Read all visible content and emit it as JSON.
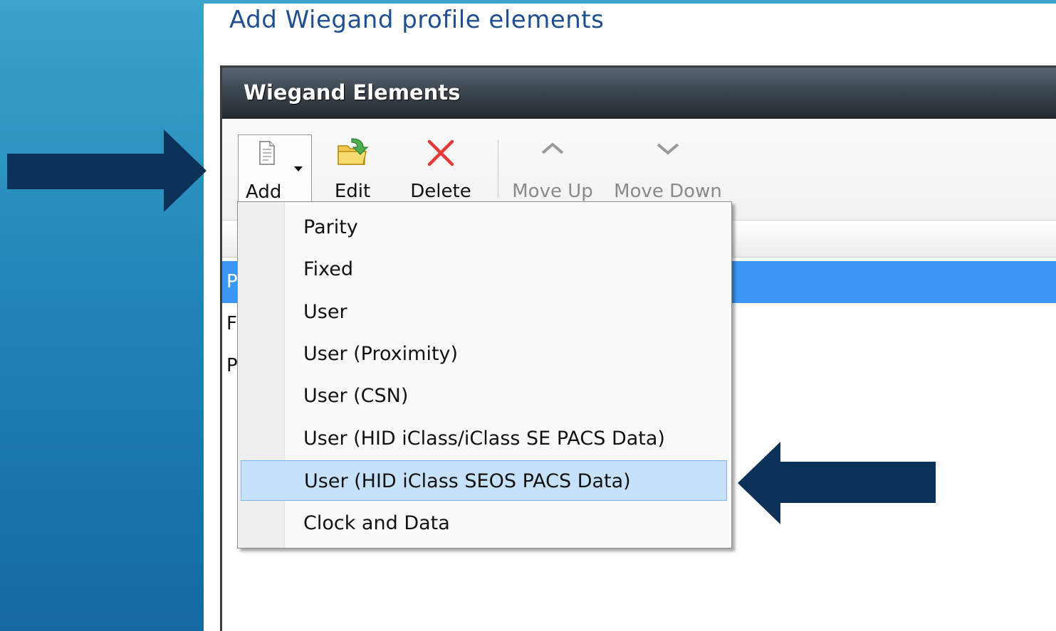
{
  "page": {
    "title": "Add Wiegand profile elements"
  },
  "panel": {
    "title": "Wiegand Elements"
  },
  "toolbar": {
    "add_label": "Add",
    "edit_label": "Edit",
    "delete_label": "Delete",
    "move_up_label": "Move Up",
    "move_down_label": "Move Down",
    "move_up_enabled": false,
    "move_down_enabled": false
  },
  "grid": {
    "rows": [
      {
        "text": "P",
        "selected": true
      },
      {
        "text": "F",
        "selected": false
      },
      {
        "text": "P",
        "selected": false
      }
    ]
  },
  "add_menu": {
    "items": [
      {
        "label": "Parity"
      },
      {
        "label": "Fixed"
      },
      {
        "label": "User"
      },
      {
        "label": "User (Proximity)"
      },
      {
        "label": "User (CSN)"
      },
      {
        "label": "User (HID iClass/iClass SE PACS Data)"
      },
      {
        "label": "User (HID iClass SEOS PACS Data)",
        "highlighted": true
      },
      {
        "label": "Clock and Data"
      }
    ]
  },
  "colors": {
    "accent_band": "#2386b8",
    "header_dark": "#2a3138",
    "selection": "#3d97f5",
    "menu_highlight": "#c6e2fb",
    "callout_arrow": "#0b3158"
  },
  "icons": {
    "add": "new-document-icon",
    "edit": "folder-edit-icon",
    "delete": "red-x-icon",
    "move_up": "chevron-up-icon",
    "move_down": "chevron-down-icon"
  }
}
